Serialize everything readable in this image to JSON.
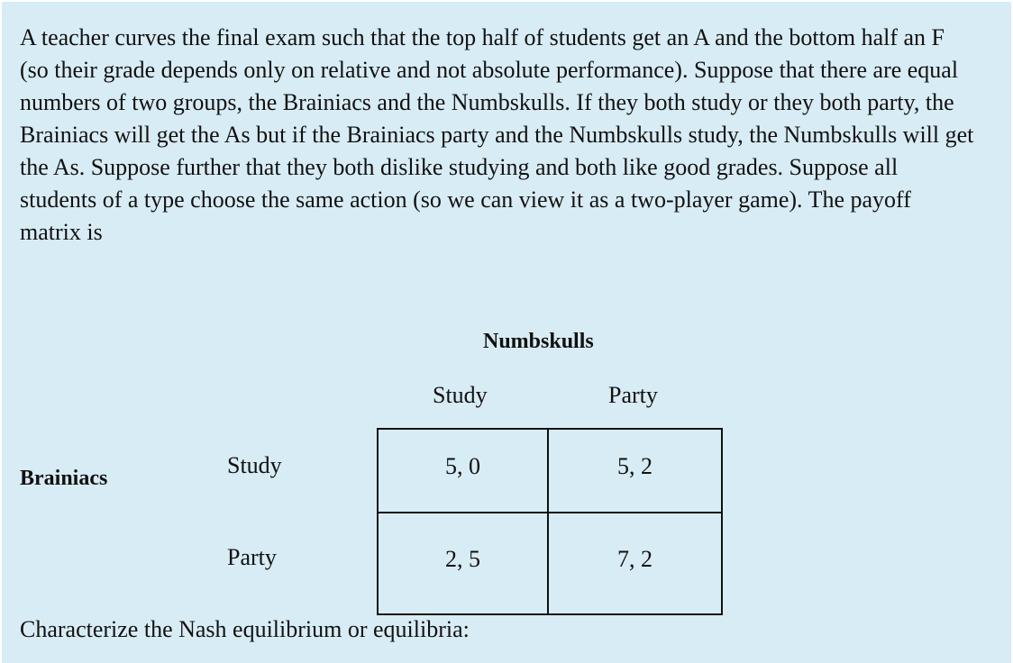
{
  "problem": {
    "text": "A teacher curves the final exam such that the top half of students get an A and the bottom half an F (so their grade depends only on relative and not absolute performance).  Suppose that there are equal numbers of two groups, the Brainiacs and the Numbskulls.  If they both study or they both party, the Brainiacs will get the As but if the Brainiacs party and the Numbskulls study, the Numbskulls will get the As.  Suppose further that they both dislike studying and both like good grades.  Suppose all students of a type choose the same action (so we can view it as a two-player game).  The payoff matrix is"
  },
  "matrix": {
    "column_player": "Numbskulls",
    "row_player": "Brainiacs",
    "column_strategies": [
      "Study",
      "Party"
    ],
    "row_strategies": [
      "Study",
      "Party"
    ],
    "payoffs": [
      [
        "5,  0",
        "5,  2"
      ],
      [
        "2,  5",
        "7,  2"
      ]
    ]
  },
  "question": {
    "text": "Characterize the Nash equilibrium or equilibria:"
  }
}
